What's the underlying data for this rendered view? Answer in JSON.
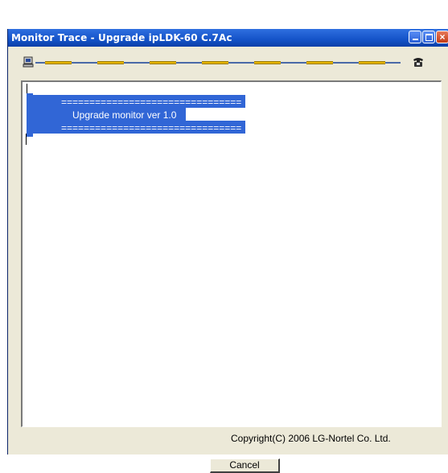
{
  "window": {
    "title": "Monitor Trace - Upgrade ipLDK-60 C.7Ac"
  },
  "log": {
    "lines": [
      "================================",
      "Upgrade monitor ver 1.0",
      "================================"
    ]
  },
  "footer": {
    "copyright": "Copyright(C) 2006 LG-Nortel Co. Ltd.",
    "cancel_label": "Cancel"
  },
  "icons": {
    "left": "computer-icon",
    "right": "telephone-icon"
  },
  "colors": {
    "titlebar": "#1453c8",
    "selection": "#3166d6",
    "progress_dash": "#e5b400"
  }
}
